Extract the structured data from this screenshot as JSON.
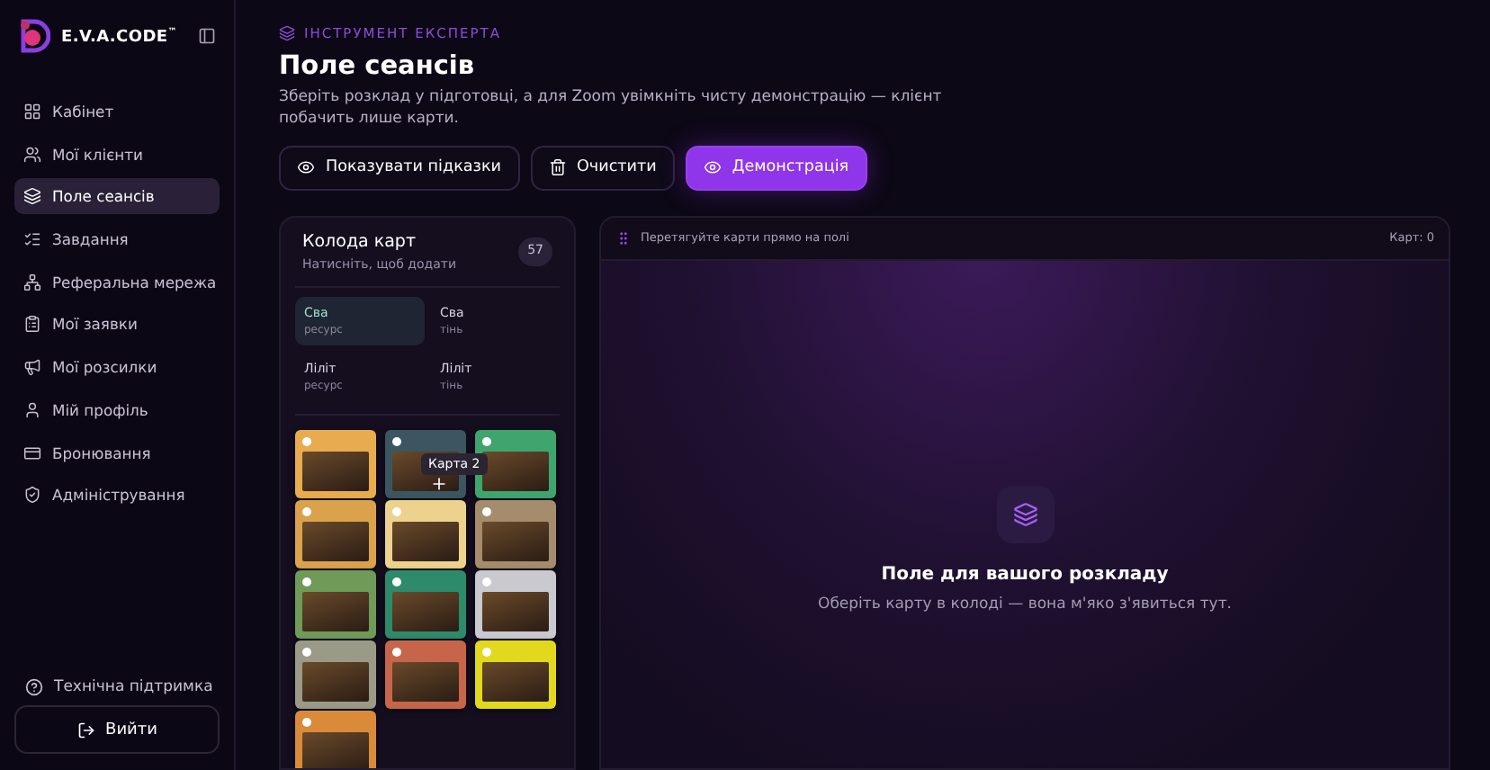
{
  "sidebar": {
    "logo": "E.V.A.CODE",
    "logo_mark": "™",
    "items": [
      {
        "label": "Кабінет",
        "selected": false
      },
      {
        "label": "Мої клієнти",
        "selected": false
      },
      {
        "label": "Поле сеансів",
        "selected": true
      },
      {
        "label": "Завдання",
        "selected": false
      },
      {
        "label": "Реферальна мережа",
        "selected": false
      },
      {
        "label": "Мої заявки",
        "selected": false
      },
      {
        "label": "Мої розсилки",
        "selected": false
      },
      {
        "label": "Мій профіль",
        "selected": false
      },
      {
        "label": "Бронювання",
        "selected": false
      },
      {
        "label": "Адміністрування",
        "selected": false
      }
    ],
    "support": "Технічна підтримка",
    "logout": "Вийти"
  },
  "header": {
    "eyebrow": "ІНСТРУМЕНТ ЕКСПЕРТА",
    "title": "Поле сеансів",
    "description": "Зберіть розклад у підготовці, а для Zoom увімкніть чисту демонстрацію — клієнт побачить лише карти."
  },
  "actions": [
    {
      "label": "Показувати підказки",
      "kind": "outline"
    },
    {
      "label": "Очистити",
      "kind": "outline"
    },
    {
      "label": "Демонстрація",
      "kind": "primary"
    }
  ],
  "deck": {
    "title": "Колода карт",
    "subtitle": "Натисніть, щоб додати",
    "count": "57",
    "decks": [
      {
        "name": "Сва",
        "type": "ресурс",
        "selected": true
      },
      {
        "name": "Сва",
        "type": "тінь",
        "selected": false
      },
      {
        "name": "Ліліт",
        "type": "ресурс",
        "selected": false
      },
      {
        "name": "Ліліт",
        "type": "тінь",
        "selected": false
      }
    ],
    "tooltip": "Карта 2",
    "cards": [
      {
        "color": "#e8ac4e"
      },
      {
        "color": "#3b5660"
      },
      {
        "color": "#3fa56e"
      },
      {
        "color": "#dba24c"
      },
      {
        "color": "#ecd28c"
      },
      {
        "color": "#a48c6c"
      },
      {
        "color": "#6f9a58"
      },
      {
        "color": "#2d8a6a"
      },
      {
        "color": "#c9c9cf"
      },
      {
        "color": "#9b9a88"
      },
      {
        "color": "#c7654a"
      },
      {
        "color": "#e2d81e"
      },
      {
        "color": "#d98b3a"
      }
    ]
  },
  "field": {
    "hint": "Перетягуйте карти прямо на полі",
    "count": "Карт: 0",
    "empty_title": "Поле для вашого розкладу",
    "empty_text": "Оберіть карту в колоді — вона м'яко з'явиться тут."
  }
}
